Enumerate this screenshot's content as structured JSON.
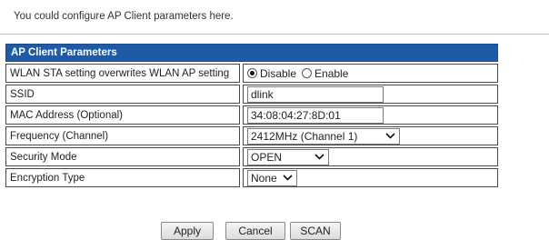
{
  "intro_text": "You could configure AP Client parameters here.",
  "section_title": "AP Client Parameters",
  "colors": {
    "title_bar": "#1f5aa6",
    "border": "#4a4a4a"
  },
  "rows": {
    "wlan_sta": {
      "label": "WLAN STA setting overwrites WLAN AP setting",
      "options": [
        "Disable",
        "Enable"
      ],
      "selected": "Disable"
    },
    "ssid": {
      "label": "SSID",
      "value": "dlink"
    },
    "mac": {
      "label": "MAC Address (Optional)",
      "value": "34:08:04:27:8D:01"
    },
    "frequency": {
      "label": "Frequency (Channel)",
      "value": "2412MHz (Channel 1)"
    },
    "security": {
      "label": "Security Mode",
      "value": "OPEN"
    },
    "encryption": {
      "label": "Encryption Type",
      "value": "None"
    }
  },
  "buttons": {
    "apply": "Apply",
    "cancel": "Cancel",
    "scan": "SCAN"
  },
  "icons": {
    "dropdown": "chevron-down-icon"
  }
}
